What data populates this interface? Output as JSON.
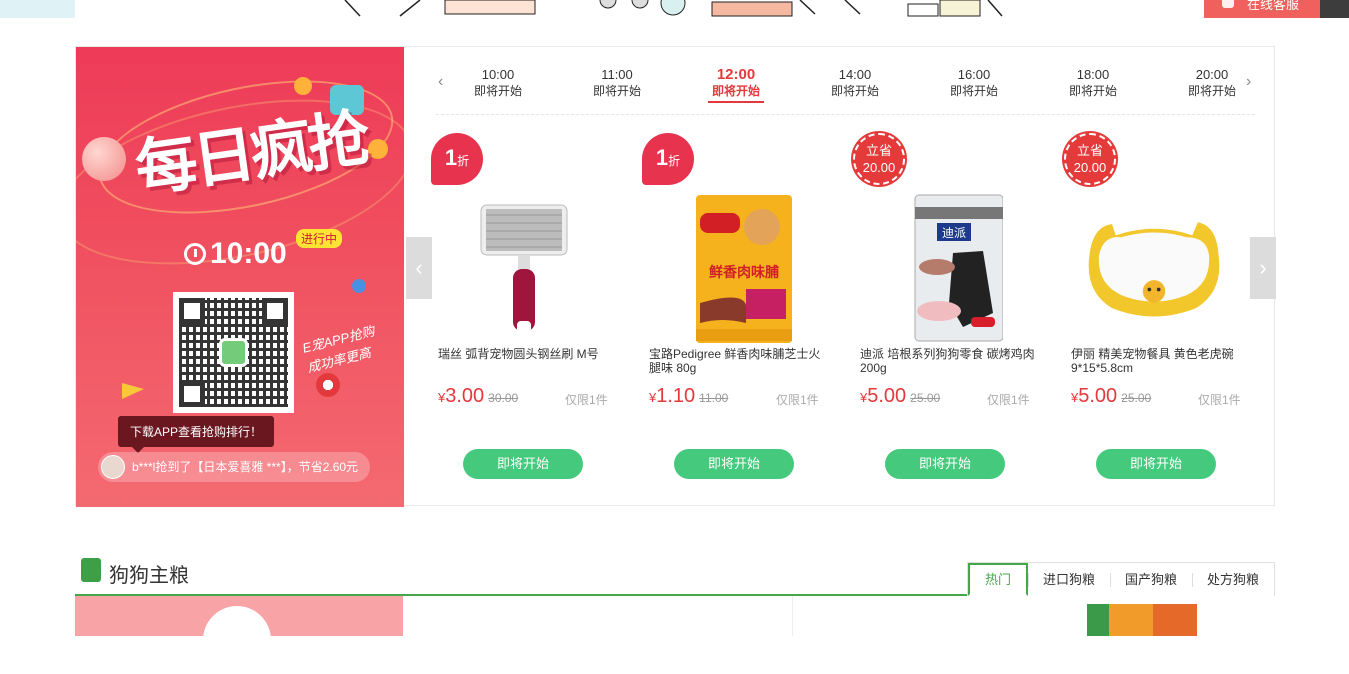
{
  "topbar": {
    "service_label": "在线客服"
  },
  "banner": {
    "title": "每日疯抢",
    "time": "10:00",
    "status_badge": "进行中",
    "slogan": "E宠APP抢购 成功率更高",
    "download_tip": "下载APP查看抢购排行！",
    "ticker": "b***l抢到了【日本爱喜雅 ***】，节省2.60元"
  },
  "timeline": {
    "slots": [
      {
        "time": "10:00",
        "status": "即将开始"
      },
      {
        "time": "11:00",
        "status": "即将开始"
      },
      {
        "time": "12:00",
        "status": "即将开始"
      },
      {
        "time": "14:00",
        "status": "即将开始"
      },
      {
        "time": "16:00",
        "status": "即将开始"
      },
      {
        "time": "18:00",
        "status": "即将开始"
      },
      {
        "time": "20:00",
        "status": "即将开始"
      }
    ],
    "active_index": 2
  },
  "products": [
    {
      "tag_num": "1",
      "tag_unit": "折",
      "name": "瑞丝 弧背宠物圆头钢丝刷 M号",
      "currency": "¥",
      "price": "3.00",
      "original": "30.00",
      "limit": "仅限1件",
      "button": "即将开始",
      "image": "steel-brush"
    },
    {
      "tag_num": "1",
      "tag_unit": "折",
      "name": "宝路Pedigree 鲜香肉味脯芝士火腿味 80g",
      "currency": "¥",
      "price": "1.10",
      "original": "11.00",
      "limit": "仅限1件",
      "button": "即将开始",
      "image": "pedigree-bag",
      "image_text": "鲜香肉味脯"
    },
    {
      "tag_top": "立省",
      "tag_bottom": "20.00",
      "name": "迪派 培根系列狗狗零食 碳烤鸡肉200g",
      "currency": "¥",
      "price": "5.00",
      "original": "25.00",
      "limit": "仅限1件",
      "button": "即将开始",
      "image": "dean-pet-bag",
      "image_text": "迪派"
    },
    {
      "tag_top": "立省",
      "tag_bottom": "20.00",
      "name": "伊丽 精美宠物餐具 黄色老虎碗 9*15*5.8cm",
      "currency": "¥",
      "price": "5.00",
      "original": "25.00",
      "limit": "仅限1件",
      "button": "即将开始",
      "image": "tiger-bowl"
    }
  ],
  "section": {
    "title": "狗狗主粮",
    "tabs": [
      "热门",
      "进口狗粮",
      "国产狗粮",
      "处方狗粮"
    ],
    "active_tab": 0
  },
  "colors": {
    "accent_red": "#e4393c",
    "button_green": "#44c97d",
    "section_green": "#46a74a"
  }
}
